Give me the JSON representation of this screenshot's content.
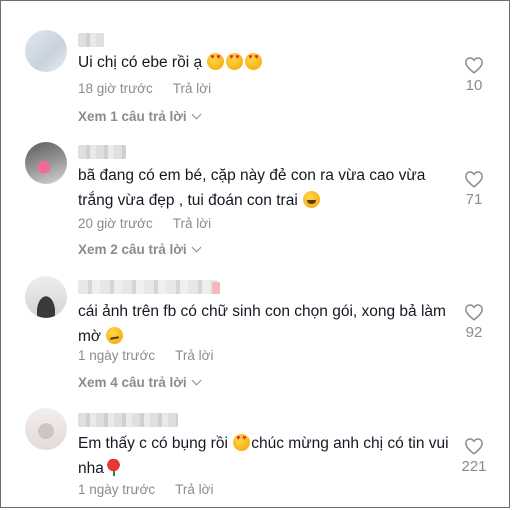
{
  "comments": [
    {
      "text": "Ui chị có ebe rồi ạ",
      "emojis": [
        "smiling-face-with-heart-eyes",
        "smiling-face-with-heart-eyes",
        "smiling-face-with-heart-eyes"
      ],
      "time": "18 giờ trước",
      "reply_label": "Trả lời",
      "view_replies": "Xem 1 câu trả lời",
      "likes": "10"
    },
    {
      "text": "bã đang có em bé, cặp này đẻ con ra vừa cao vừa trắng vừa đẹp , tui đoán con trai",
      "emojis": [
        "grinning-face"
      ],
      "time": "20 giờ trước",
      "reply_label": "Trả lời",
      "view_replies": "Xem 2 câu trả lời",
      "likes": "71"
    },
    {
      "text": "cái ảnh trên fb có chữ sinh con chọn gói, xong bả làm mờ",
      "emojis": [
        "smirking-face"
      ],
      "time": "1 ngày trước",
      "reply_label": "Trả lời",
      "view_replies": "Xem 4 câu trả lời",
      "likes": "92"
    },
    {
      "text_before": "Em thấy c có bụng rồi",
      "text_after": "chúc mừng anh chị có tin vui nha",
      "emojis": [
        "smiling-face-with-heart-eyes",
        "rose"
      ],
      "time": "1 ngày trước",
      "reply_label": "Trả lời",
      "likes": "221"
    }
  ],
  "colors": {
    "text": "#161823",
    "secondary": "#8a8b91",
    "background": "#ffffff"
  }
}
